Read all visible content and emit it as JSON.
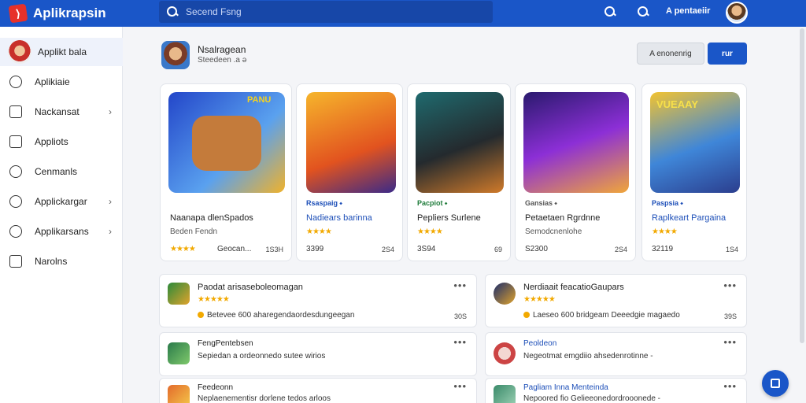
{
  "app": {
    "name": "Aplikrapsin"
  },
  "search": {
    "placeholder": "Secend Fsng"
  },
  "user": {
    "label": "A pentaeiir"
  },
  "sidebar": {
    "items": [
      {
        "label": "Applikt bala",
        "icon": "avatar"
      },
      {
        "label": "Aplikiaie",
        "icon": "star-icon"
      },
      {
        "label": "Nackansat",
        "icon": "download-icon"
      },
      {
        "label": "Appliots",
        "icon": "bag-icon"
      },
      {
        "label": "Cenmanls",
        "icon": "cloud-icon"
      },
      {
        "label": "Applickargar",
        "icon": "clock-icon"
      },
      {
        "label": "Applikarsans",
        "icon": "compass-icon"
      },
      {
        "label": "Narolns",
        "icon": "hand-icon"
      }
    ]
  },
  "header": {
    "title": "Nsalragean",
    "subtitle": "Steedeen .a ə"
  },
  "actions": {
    "secondary": "A enonenrig",
    "primary": "rur"
  },
  "cards": [
    {
      "category": "",
      "title": "Naanapa dlenSpados",
      "subtitle": "Beden Fendn",
      "stars": "★★★★",
      "rating_meta": "Geocan...",
      "count": "1S3H",
      "thumb_badge": "PANU"
    },
    {
      "category": "Rsaspaig ⬩",
      "title": "Nadiears barinna",
      "subtitle": "",
      "stars": "★★★★",
      "rating_meta": "3399",
      "count": "2S4"
    },
    {
      "category": "Pacpiot ⬩",
      "title": "Pepliers Surlene",
      "subtitle": "",
      "stars": "★★★★",
      "rating_meta": "3S94",
      "count": "69"
    },
    {
      "category": "Gansias ⬩",
      "title": "Petaetaen Rgrdnne",
      "subtitle": "Semodcnenlohe",
      "stars": "",
      "rating_meta": "S2300",
      "count": "2S4"
    },
    {
      "category": "Paspsia ⬩",
      "title": "Raplkeart Pargaina",
      "subtitle": "",
      "stars": "★★★★",
      "rating_meta": "32119",
      "count": "1S4",
      "thumb_badge": "VUEAAY"
    }
  ],
  "rows": [
    {
      "title": "Paodat arisaseboleomagan",
      "stars": "★★★★★",
      "desc": "Betevee 600 aharegendaordesdungeegan",
      "count": "30S"
    },
    {
      "title": "Nerdiaait feacatioGaupars",
      "stars": "★★★★★",
      "desc": "Laeseo 600 bridgeam Deeedgie magaedo",
      "count": "39S"
    },
    {
      "title": "FengPentebsen",
      "stars": "",
      "desc": "Sepiedan a ordeonnedo sutee wirios",
      "count": ""
    },
    {
      "title": "Peoldeon",
      "stars": "",
      "desc": "Negeotmat emgdiio ahsedenrotinne -",
      "count": ""
    },
    {
      "title": "Feedeonn",
      "stars": "",
      "desc": "Neplaenementisr dorlene tedos arloos",
      "count": ""
    },
    {
      "title": "Pagliam Inna Menteinda",
      "stars": "",
      "desc": "Nepoored fio Gelieeonedordrooonede -",
      "count": ""
    }
  ],
  "colors": {
    "brand": "#1a56c8",
    "star": "#f2a900",
    "link": "#1d4fb8"
  }
}
